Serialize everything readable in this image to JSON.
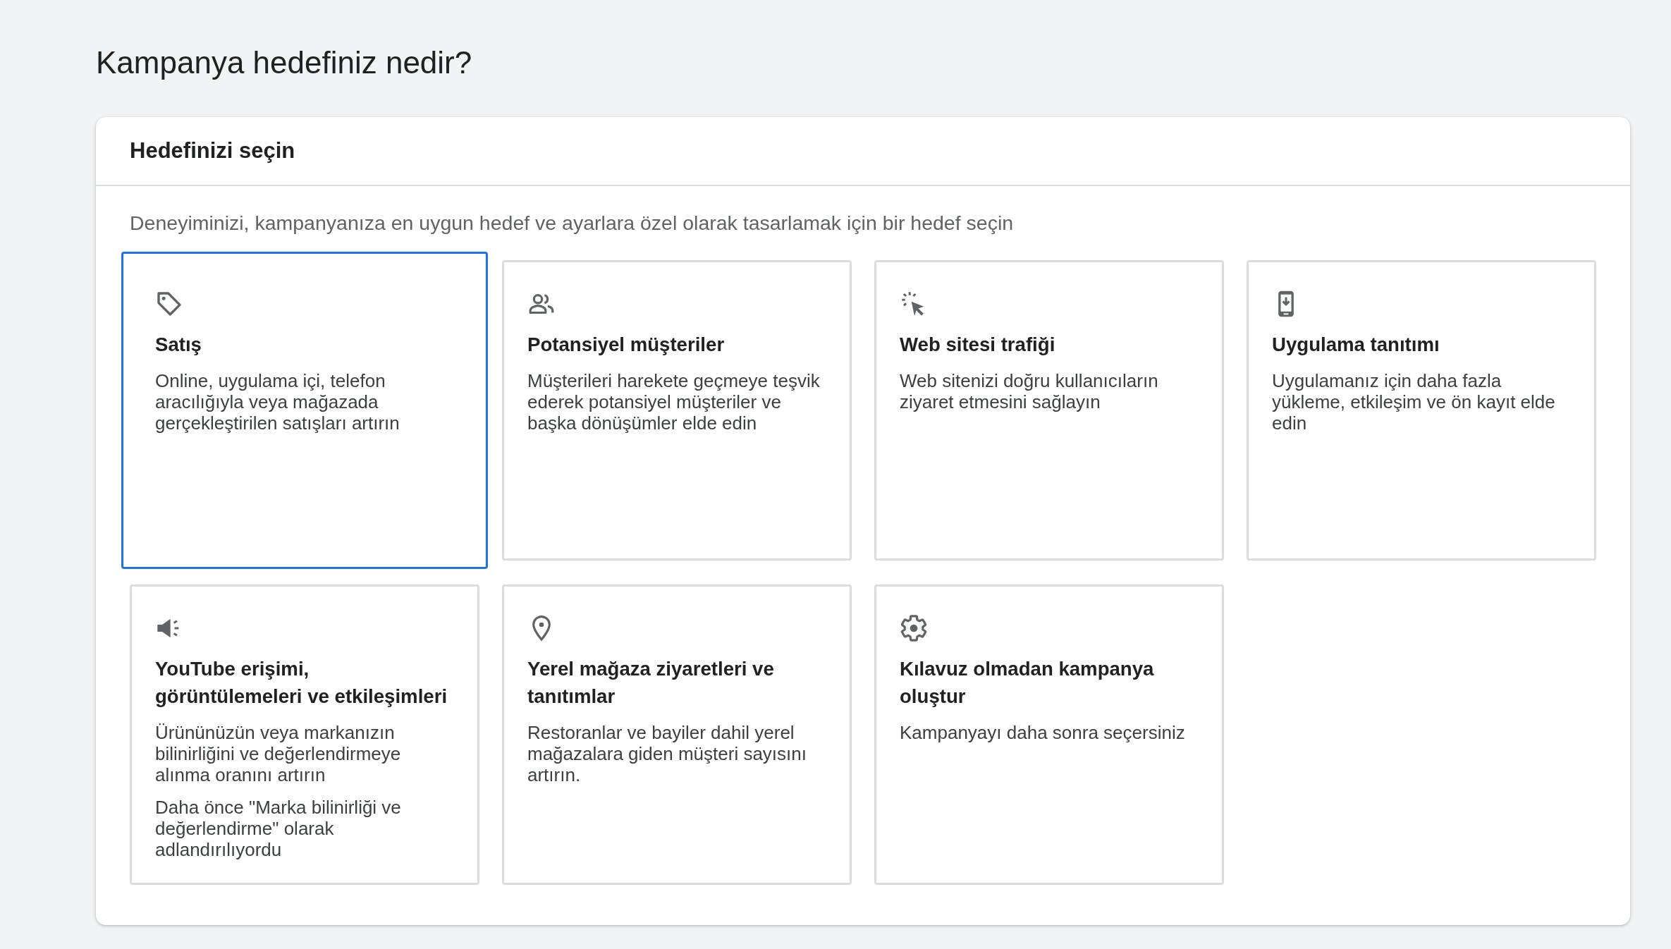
{
  "page_title": "Kampanya hedefiniz nedir?",
  "panel": {
    "title": "Hedefinizi seçin",
    "instruction": "Deneyiminizi, kampanyanıza en uygun hedef ve ayarlara özel olarak tasarlamak için bir hedef seçin",
    "goals": [
      {
        "title": "Satış",
        "description": "Online, uygulama içi, telefon aracılığıyla veya mağazada gerçekleştirilen satışları artırın",
        "selected": true
      },
      {
        "title": "Potansiyel müşteriler",
        "description": "Müşterileri harekete geçmeye teşvik ederek potansiyel müşteriler ve başka dönüşümler elde edin",
        "selected": false
      },
      {
        "title": "Web sitesi trafiği",
        "description": "Web sitenizi doğru kullanıcıların ziyaret etmesini sağlayın",
        "selected": false
      },
      {
        "title": "Uygulama tanıtımı",
        "description": "Uygulamanız için daha fazla yükleme, etkileşim ve ön kayıt elde edin",
        "selected": false
      },
      {
        "title": "YouTube erişimi, görüntülemeleri ve etkileşimleri",
        "description": "Ürününüzün veya markanızın bilinirliğini ve değerlendirmeye alınma oranını artırın",
        "note": "Daha önce \"Marka bilinirliği ve değerlendirme\" olarak adlandırılıyordu",
        "selected": false
      },
      {
        "title": "Yerel mağaza ziyaretleri ve tanıtımlar",
        "description": "Restoranlar ve bayiler dahil yerel mağazalara giden müşteri sayısını artırın.",
        "selected": false
      },
      {
        "title": "Kılavuz olmadan kampanya oluştur",
        "description": "Kampanyayı daha sonra seçersiniz",
        "selected": false
      }
    ]
  }
}
